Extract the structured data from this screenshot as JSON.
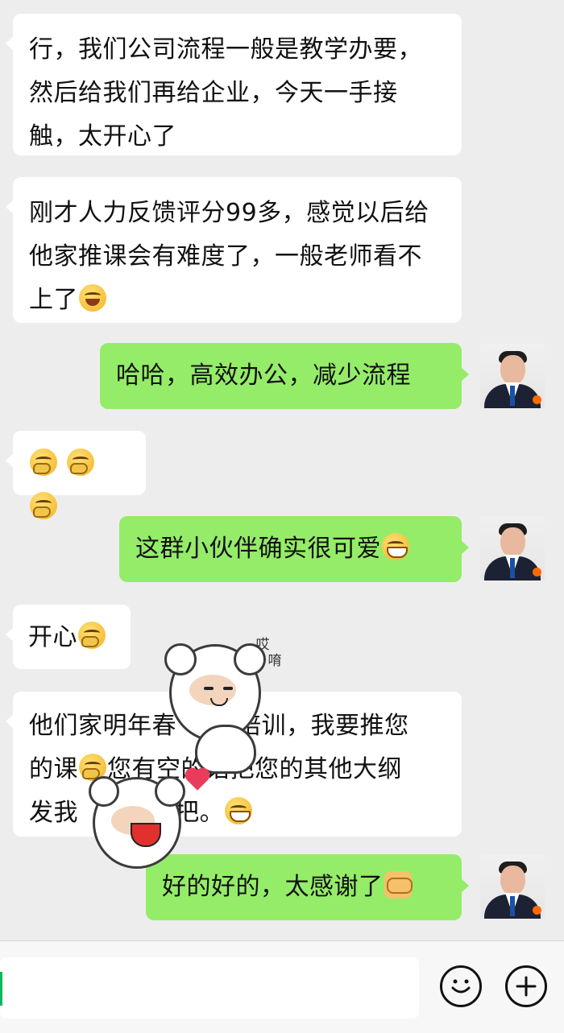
{
  "messages": [
    {
      "side": "left",
      "text": "行，我们公司流程一般是教学办要，然后给我们再给企业，今天一手接触，太开心了"
    },
    {
      "side": "left",
      "parts": [
        {
          "text": "刚才人力反馈评分99多，感觉以后给他家推课会有难度了，一般老师看不上了"
        },
        {
          "emoji": "laughing-tears-emoji"
        }
      ]
    },
    {
      "side": "right",
      "text": "哈哈，高效办公，减少流程"
    },
    {
      "side": "left",
      "parts": [
        {
          "emoji": "thinking-emoji"
        },
        {
          "emoji": "thinking-emoji"
        },
        {
          "emoji": "thinking-emoji"
        }
      ]
    },
    {
      "side": "right",
      "parts": [
        {
          "text": "这群小伙伴确实很可爱"
        },
        {
          "emoji": "grinning-emoji"
        }
      ]
    },
    {
      "side": "left",
      "parts": [
        {
          "text": "开心"
        },
        {
          "emoji": "thinking-emoji"
        }
      ]
    },
    {
      "side": "left",
      "line1": "他们家明年春",
      "line1b": "培训，我要推您",
      "line2a": "的课",
      "line2b": "您有空的话把您的其他大纲",
      "line3a": "发我",
      "line3b": "把。",
      "emoji_grin": "grinning-emoji",
      "emoji_think": "thinking-emoji"
    },
    {
      "side": "right",
      "parts": [
        {
          "text": "好的好的，太感谢了"
        },
        {
          "emoji": "handshake-emoji"
        }
      ]
    }
  ],
  "sticker": {
    "text1": "哎",
    "text2": "唷"
  },
  "bottom_bar": {
    "emoji_button": "emoji-button",
    "add_button": "add-button"
  }
}
